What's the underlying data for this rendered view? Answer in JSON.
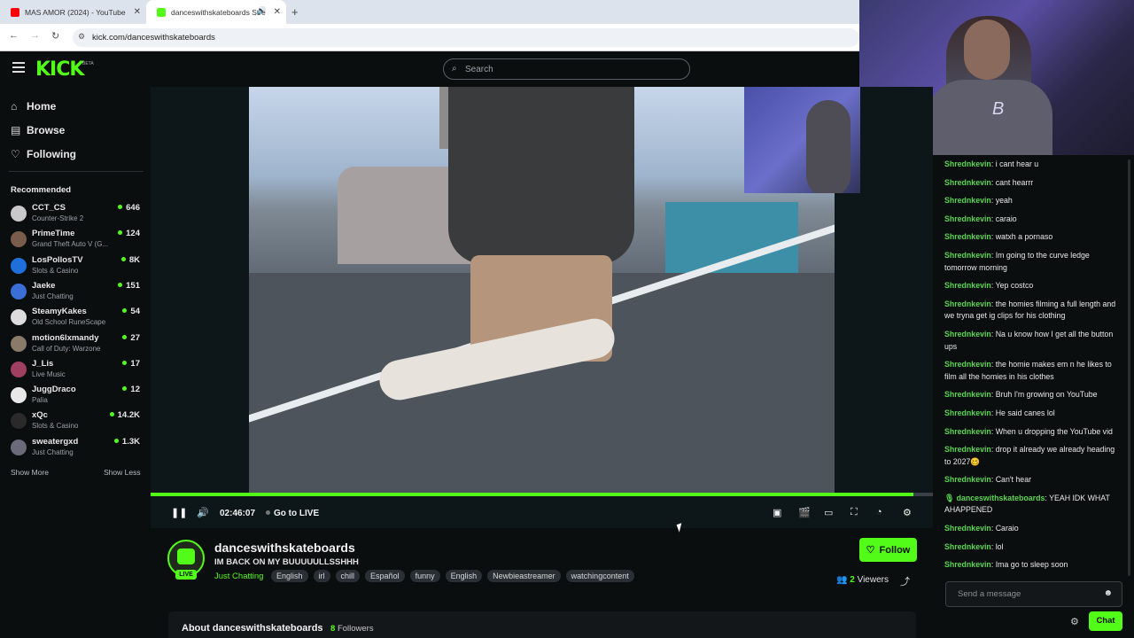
{
  "browser": {
    "tabs": [
      {
        "title": "MAS AMOR (2024) - YouTube",
        "favicon_color": "#ff0000"
      },
      {
        "title": "danceswithskateboards Stre",
        "favicon_color": "#53fc18"
      }
    ],
    "new_tab": "+",
    "url": "kick.com/danceswithskateboards"
  },
  "header": {
    "logo": "KICK",
    "beta": "BETA",
    "search_placeholder": "Search"
  },
  "sidebar": {
    "nav": [
      {
        "label": "Home",
        "icon": "home-icon"
      },
      {
        "label": "Browse",
        "icon": "browse-icon"
      },
      {
        "label": "Following",
        "icon": "heart-icon"
      }
    ],
    "recommended_title": "Recommended",
    "recommended": [
      {
        "name": "CCT_CS",
        "game": "Counter-Strike 2",
        "viewers": "646",
        "color": "#c9c9c9"
      },
      {
        "name": "PrimeTime",
        "game": "Grand Theft Auto V (G...",
        "viewers": "124",
        "color": "#7a5c4a"
      },
      {
        "name": "LosPollosTV",
        "game": "Slots & Casino",
        "viewers": "8K",
        "color": "#1e6fd9"
      },
      {
        "name": "Jaeke",
        "game": "Just Chatting",
        "viewers": "151",
        "color": "#3a6fd8"
      },
      {
        "name": "SteamyKakes",
        "game": "Old School RuneScape",
        "viewers": "54",
        "color": "#ddd"
      },
      {
        "name": "motion6lxmandy",
        "game": "Call of Duty: Warzone",
        "viewers": "27",
        "color": "#8a7a6a"
      },
      {
        "name": "J_Lis",
        "game": "Live Music",
        "viewers": "17",
        "color": "#a04060"
      },
      {
        "name": "JuggDraco",
        "game": "Palia",
        "viewers": "12",
        "color": "#e8e8e8"
      },
      {
        "name": "xQc",
        "game": "Slots & Casino",
        "viewers": "14.2K",
        "color": "#2a2a2a"
      },
      {
        "name": "sweatergxd",
        "game": "Just Chatting",
        "viewers": "1.3K",
        "color": "#6a6a7a"
      }
    ],
    "show_more": "Show More",
    "show_less": "Show Less"
  },
  "player": {
    "time": "02:46:07",
    "go_live": "Go to LIVE",
    "progress_fraction": 0.975
  },
  "channel": {
    "name": "danceswithskateboards",
    "title": "IM BACK ON MY BUUUUULLSSHHH",
    "category": "Just Chatting",
    "live_badge": "LIVE",
    "tags": [
      "English",
      "irl",
      "chill",
      "Español",
      "funny",
      "English",
      "Newbieastreamer",
      "watchingcontent"
    ],
    "follow_label": "Follow",
    "viewers_count": "2",
    "viewers_label": "Viewers"
  },
  "about": {
    "title": "About danceswithskateboards",
    "followers_count": "8",
    "followers_label": "Followers"
  },
  "chat": {
    "messages": [
      {
        "user": "Shrednkevin",
        "text": "i cant hear u"
      },
      {
        "user": "Shrednkevin",
        "text": "cant hearrr"
      },
      {
        "user": "Shrednkevin",
        "text": "yeah"
      },
      {
        "user": "Shrednkevin",
        "text": "caraio"
      },
      {
        "user": "Shrednkevin",
        "text": "watxh a pornaso"
      },
      {
        "user": "Shrednkevin",
        "text": "Im going to the curve ledge tomorrow morning"
      },
      {
        "user": "Shrednkevin",
        "text": "Yep costco"
      },
      {
        "user": "Shrednkevin",
        "text": "the homies filming a full length and we tryna get ig clips for his clothing"
      },
      {
        "user": "Shrednkevin",
        "text": "Na u know how I get all the button ups"
      },
      {
        "user": "Shrednkevin",
        "text": "the homie makes em n he likes to film all the homies in his clothes"
      },
      {
        "user": "Shrednkevin",
        "text": "Bruh I'm growing on YouTube"
      },
      {
        "user": "Shrednkevin",
        "text": "He said canes lol"
      },
      {
        "user": "Shrednkevin",
        "text": "When u dropping the YouTube vid"
      },
      {
        "user": "Shrednkevin",
        "text": "drop it already we already heading to 2027🥴"
      },
      {
        "user": "Shrednkevin",
        "text": "Can't hear"
      },
      {
        "user": "🎙 danceswithskateboards",
        "text": "YEAH IDK WHAT AHAPPENED"
      },
      {
        "user": "Shrednkevin",
        "text": "Caraio"
      },
      {
        "user": "Shrednkevin",
        "text": "lol"
      },
      {
        "user": "Shrednkevin",
        "text": "Ima go to sleep soon"
      }
    ],
    "input_placeholder": "Send a message",
    "chat_button": "Chat"
  }
}
